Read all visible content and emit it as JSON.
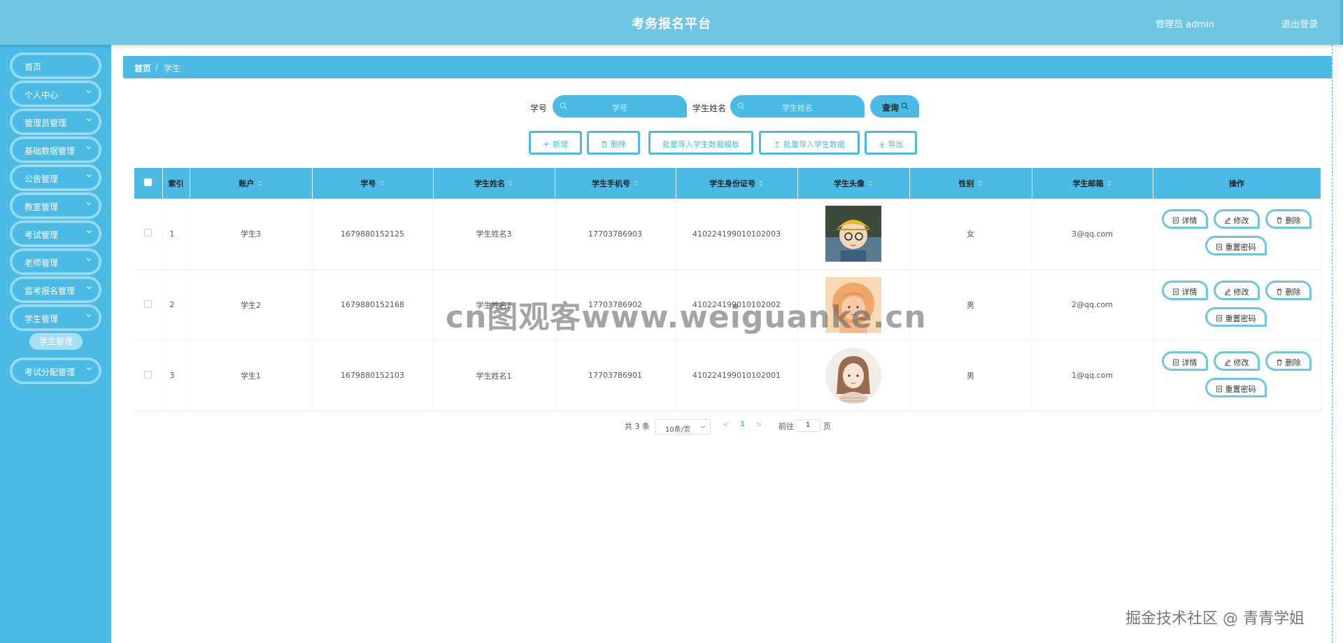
{
  "header": {
    "title": "考务报名平台",
    "user": "管理员 admin",
    "logout": "退出登录"
  },
  "sidebar": {
    "items": [
      {
        "label": "首页",
        "has_children": false
      },
      {
        "label": "个人中心",
        "has_children": true
      },
      {
        "label": "管理员管理",
        "has_children": true
      },
      {
        "label": "基础数据管理",
        "has_children": true
      },
      {
        "label": "公告管理",
        "has_children": true
      },
      {
        "label": "教室管理",
        "has_children": true
      },
      {
        "label": "考试管理",
        "has_children": true
      },
      {
        "label": "老师管理",
        "has_children": true
      },
      {
        "label": "监考报名管理",
        "has_children": true
      },
      {
        "label": "学生管理",
        "has_children": true,
        "expanded": true
      },
      {
        "label": "考试分配管理",
        "has_children": true
      }
    ],
    "active_sub": "学生管理"
  },
  "breadcrumb": {
    "home": "首页",
    "separator": "/",
    "current": "学生"
  },
  "search": {
    "student_no_label": "学号",
    "student_no_placeholder": "学号",
    "student_name_label": "学生姓名",
    "student_name_placeholder": "学生姓名",
    "query_button": "查询"
  },
  "actions": {
    "add": "新增",
    "delete": "删除",
    "template": "批量导入学生数据模板",
    "import": "批量导入学生数据",
    "export": "导出"
  },
  "table": {
    "columns": [
      "索引",
      "账户",
      "学号",
      "学生姓名",
      "学生手机号",
      "学生身份证号",
      "学生头像",
      "性别",
      "学生邮箱",
      "操作"
    ],
    "rows": [
      {
        "index": "1",
        "account": "学生3",
        "student_no": "1679880152125",
        "name": "学生姓名3",
        "phone": "17703786903",
        "id_card": "410224199010102003",
        "avatar": "boy-yellow-hat",
        "gender": "女",
        "email": "3@qq.com"
      },
      {
        "index": "2",
        "account": "学生2",
        "student_no": "1679880152168",
        "name": "学生姓名2",
        "phone": "17703786902",
        "id_card": "410224199010102002",
        "avatar": "girl-orange",
        "gender": "男",
        "email": "2@qq.com"
      },
      {
        "index": "3",
        "account": "学生1",
        "student_no": "1679880152103",
        "name": "学生姓名1",
        "phone": "17703786901",
        "id_card": "410224199010102001",
        "avatar": "girl-illustration",
        "gender": "男",
        "email": "1@qq.com"
      }
    ],
    "ops": {
      "detail": "详情",
      "edit": "修改",
      "delete": "删除",
      "reset_password": "重置密码"
    }
  },
  "pagination": {
    "total": "共 3 条",
    "page_size": "10条/页",
    "prev": "<",
    "current": "1",
    "next": ">",
    "goto_label": "前往",
    "goto_value": "1",
    "page_suffix": "页"
  },
  "watermarks": {
    "center": "cn图观客www.weiguanke.cn",
    "corner": "掘金技术社区 @ 青青学姐"
  },
  "colors": {
    "header": "#6ec6e2",
    "primary": "#4bbbe6",
    "button_border": "#6ec6e2"
  }
}
